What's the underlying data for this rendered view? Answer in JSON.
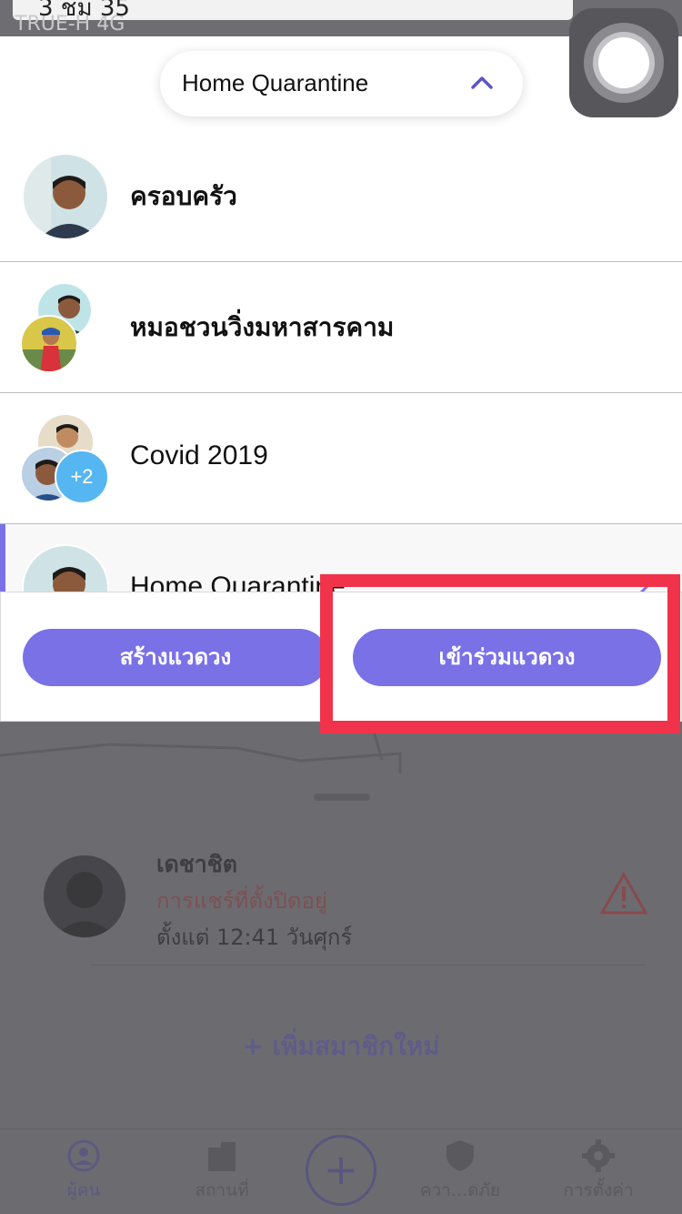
{
  "status_bar": {
    "time": "3 ชม 35",
    "carrier": "TRUE-H  4G"
  },
  "header": {
    "selected_circle": "Home Quarantine",
    "chevron_icon": "chevron-up-icon"
  },
  "circles": [
    {
      "name": "ครอบครัว",
      "avatars": 1
    },
    {
      "name": "หมอชวนวิ่งมหาสารคาม",
      "avatars": 2
    },
    {
      "name": "Covid 2019",
      "avatars": 2,
      "extra_count": "+2"
    },
    {
      "name": "Home Quarantine",
      "avatars": 1,
      "selected": true
    }
  ],
  "actions": {
    "create_label": "สร้างแวดวง",
    "join_label": "เข้าร่วมแวดวง"
  },
  "background": {
    "member_name": "เดชาชิต",
    "member_status": "การแชร์ที่ตั้งปิดอยู่",
    "member_since": "ตั้งแต่ 12:41 วันศุกร์",
    "add_member": "+ เพิ่มสมาชิกใหม่",
    "tabs": [
      {
        "label": "ผู้คน",
        "icon": "person-icon"
      },
      {
        "label": "สถานที่",
        "icon": "building-icon"
      },
      {
        "label": "",
        "icon": "plus-icon"
      },
      {
        "label": "ควา...ดภัย",
        "icon": "shield-icon"
      },
      {
        "label": "การตั้งค่า",
        "icon": "gear-icon"
      }
    ]
  },
  "colors": {
    "accent": "#7a71e6",
    "badge": "#55b6f1",
    "highlight": "#f0334b",
    "warning": "#c0474d"
  }
}
